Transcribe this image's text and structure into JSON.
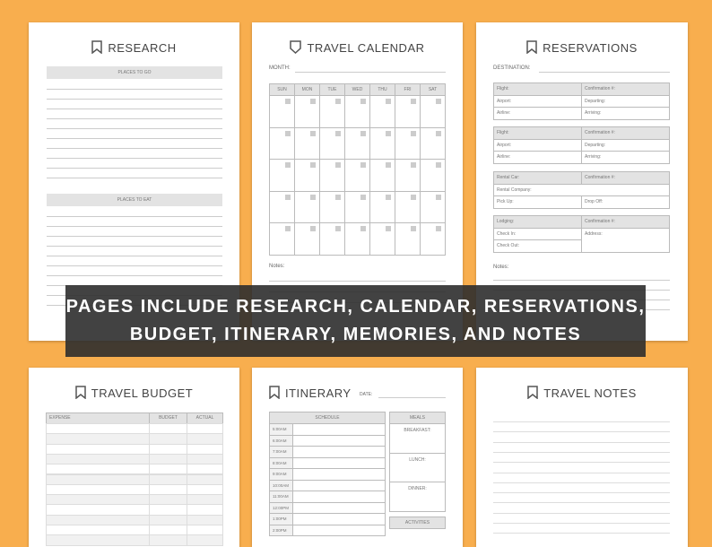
{
  "research": {
    "title": "RESEARCH",
    "sections": [
      "PLACES TO GO",
      "PLACES TO EAT"
    ]
  },
  "calendar": {
    "title": "TRAVEL CALENDAR",
    "month_label": "MONTH:",
    "days": [
      "SUN",
      "MON",
      "TUE",
      "WED",
      "THU",
      "FRI",
      "SAT"
    ],
    "notes_label": "Notes:"
  },
  "reservations": {
    "title": "RESERVATIONS",
    "destination_label": "DESTINATION:",
    "notes_label": "Notes:",
    "blocks": [
      {
        "rows": [
          [
            "Flight:",
            "Confirmation #:"
          ],
          [
            "Airport:",
            "Departing:"
          ],
          [
            "Airline:",
            "Arriving:"
          ]
        ]
      },
      {
        "rows": [
          [
            "Flight:",
            "Confirmation #:"
          ],
          [
            "Airport:",
            "Departing:"
          ],
          [
            "Airline:",
            "Arriving:"
          ]
        ]
      },
      {
        "rows": [
          [
            "Rental Car:",
            "Confirmation #:"
          ],
          [
            "Rental Company:",
            ""
          ],
          [
            "Pick Up:",
            "Drop Off:"
          ]
        ]
      },
      {
        "rows": [
          [
            "Lodging:",
            "Confirmation #:"
          ],
          [
            "Check In:",
            "Address:"
          ],
          [
            "Check Out:",
            ""
          ]
        ]
      }
    ]
  },
  "budget": {
    "title": "TRAVEL BUDGET",
    "columns": [
      "EXPENSE",
      "BUDGET",
      "ACTUAL"
    ]
  },
  "itinerary": {
    "title": "ITINERARY",
    "date_label": "DATE:",
    "schedule_label": "SCHEDULE",
    "times": [
      "5:00AM",
      "6:00AM",
      "7:00AM",
      "8:00AM",
      "9:00AM",
      "10:00AM",
      "11:00AM",
      "12:00PM",
      "1:00PM",
      "2:00PM"
    ],
    "meals_label": "MEALS",
    "meals": [
      "BREAKFAST:",
      "LUNCH:",
      "DINNER:"
    ],
    "activities_label": "ACTIVITIES"
  },
  "notes": {
    "title": "TRAVEL NOTES"
  },
  "banner": {
    "line1": "PAGES INCLUDE RESEARCH, CALENDAR, RESERVATIONS,",
    "line2": "BUDGET, ITINERARY, MEMORIES, AND NOTES"
  }
}
